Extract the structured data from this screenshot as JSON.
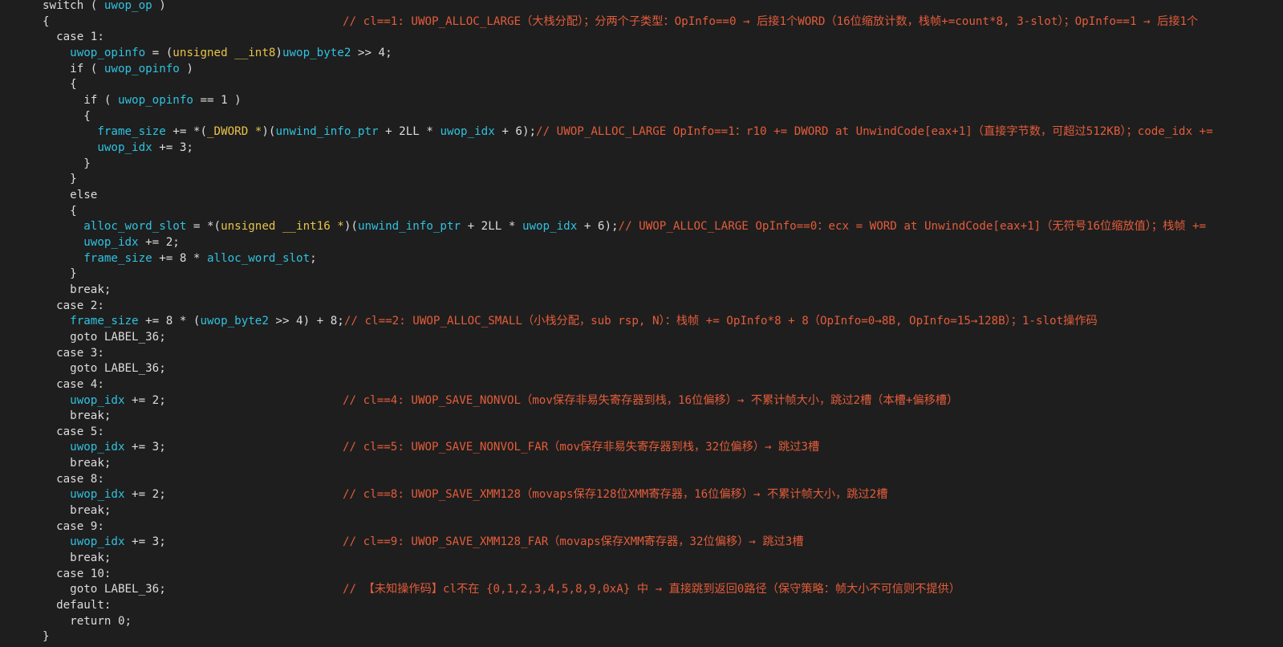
{
  "lines": [
    {
      "segs": [
        [
          "kw",
          "switch ( "
        ],
        [
          "var",
          "uwop_op"
        ],
        [
          "kw",
          " )"
        ]
      ]
    },
    {
      "segs": [
        [
          "kw",
          "{"
        ]
      ],
      "comment": "// cl==1: UWOP_ALLOC_LARGE（大栈分配）；分两个子类型：OpInfo==0 → 后接1个WORD（16位缩放计数，栈帧+=count*8, 3-slot）；OpInfo==1 → 后接1个"
    },
    {
      "segs": [
        [
          "kw",
          "  case 1:"
        ]
      ]
    },
    {
      "segs": [
        [
          "var",
          "    uwop_opinfo"
        ],
        [
          "op",
          " = ("
        ],
        [
          "typ",
          "unsigned __int8"
        ],
        [
          "op",
          ")"
        ],
        [
          "var",
          "uwop_byte2"
        ],
        [
          "op",
          " >> 4;"
        ]
      ]
    },
    {
      "segs": [
        [
          "kw",
          "    if ( "
        ],
        [
          "var",
          "uwop_opinfo"
        ],
        [
          "kw",
          " )"
        ]
      ]
    },
    {
      "segs": [
        [
          "kw",
          "    {"
        ]
      ]
    },
    {
      "segs": [
        [
          "kw",
          "      if ( "
        ],
        [
          "var",
          "uwop_opinfo"
        ],
        [
          "kw",
          " == 1 )"
        ]
      ]
    },
    {
      "segs": [
        [
          "kw",
          "      {"
        ]
      ]
    },
    {
      "segs": [
        [
          "var",
          "        frame_size"
        ],
        [
          "op",
          " += *("
        ],
        [
          "typ",
          "_DWORD *"
        ],
        [
          "op",
          ")("
        ],
        [
          "var",
          "unwind_info_ptr"
        ],
        [
          "op",
          " + 2LL * "
        ],
        [
          "var",
          "uwop_idx"
        ],
        [
          "op",
          " + 6);"
        ]
      ],
      "inline": "// UWOP_ALLOC_LARGE OpInfo==1：r10 += DWORD at UnwindCode[eax+1]（直接字节数，可超过512KB）；code_idx +="
    },
    {
      "segs": [
        [
          "var",
          "        uwop_idx"
        ],
        [
          "op",
          " += 3;"
        ]
      ]
    },
    {
      "segs": [
        [
          "kw",
          "      }"
        ]
      ]
    },
    {
      "segs": [
        [
          "kw",
          "    }"
        ]
      ]
    },
    {
      "segs": [
        [
          "kw",
          "    else"
        ]
      ]
    },
    {
      "segs": [
        [
          "kw",
          "    {"
        ]
      ]
    },
    {
      "segs": [
        [
          "var",
          "      alloc_word_slot"
        ],
        [
          "op",
          " = *("
        ],
        [
          "typ",
          "unsigned __int16 *"
        ],
        [
          "op",
          ")("
        ],
        [
          "var",
          "unwind_info_ptr"
        ],
        [
          "op",
          " + 2LL * "
        ],
        [
          "var",
          "uwop_idx"
        ],
        [
          "op",
          " + 6);"
        ]
      ],
      "inline": "// UWOP_ALLOC_LARGE OpInfo==0：ecx = WORD at UnwindCode[eax+1]（无符号16位缩放值）；栈帧 +="
    },
    {
      "segs": [
        [
          "var",
          "      uwop_idx"
        ],
        [
          "op",
          " += 2;"
        ]
      ]
    },
    {
      "segs": [
        [
          "var",
          "      frame_size"
        ],
        [
          "op",
          " += 8 * "
        ],
        [
          "var",
          "alloc_word_slot"
        ],
        [
          "op",
          ";"
        ]
      ]
    },
    {
      "segs": [
        [
          "kw",
          "    }"
        ]
      ]
    },
    {
      "segs": [
        [
          "kw",
          "    break;"
        ]
      ]
    },
    {
      "segs": [
        [
          "kw",
          "  case 2:"
        ]
      ]
    },
    {
      "segs": [
        [
          "var",
          "    frame_size"
        ],
        [
          "op",
          " += 8 * ("
        ],
        [
          "var",
          "uwop_byte2"
        ],
        [
          "op",
          " >> 4) + 8;"
        ]
      ],
      "inline": "// cl==2: UWOP_ALLOC_SMALL（小栈分配，sub rsp, N）：栈帧 += OpInfo*8 + 8（OpInfo=0→8B, OpInfo=15→128B）；1-slot操作码"
    },
    {
      "segs": [
        [
          "kw",
          "    goto LABEL_36;"
        ]
      ]
    },
    {
      "segs": [
        [
          "kw",
          "  case 3:"
        ]
      ]
    },
    {
      "segs": [
        [
          "kw",
          "    goto LABEL_36;"
        ]
      ]
    },
    {
      "segs": [
        [
          "kw",
          "  case 4:"
        ]
      ]
    },
    {
      "segs": [
        [
          "var",
          "    uwop_idx"
        ],
        [
          "op",
          " += 2;"
        ]
      ],
      "comment": "// cl==4: UWOP_SAVE_NONVOL（mov保存非易失寄存器到栈，16位偏移）→ 不累计帧大小，跳过2槽（本槽+偏移槽）"
    },
    {
      "segs": [
        [
          "kw",
          "    break;"
        ]
      ]
    },
    {
      "segs": [
        [
          "kw",
          "  case 5:"
        ]
      ]
    },
    {
      "segs": [
        [
          "var",
          "    uwop_idx"
        ],
        [
          "op",
          " += 3;"
        ]
      ],
      "comment": "// cl==5: UWOP_SAVE_NONVOL_FAR（mov保存非易失寄存器到栈，32位偏移）→ 跳过3槽"
    },
    {
      "segs": [
        [
          "kw",
          "    break;"
        ]
      ]
    },
    {
      "segs": [
        [
          "kw",
          "  case 8:"
        ]
      ]
    },
    {
      "segs": [
        [
          "var",
          "    uwop_idx"
        ],
        [
          "op",
          " += 2;"
        ]
      ],
      "comment": "// cl==8: UWOP_SAVE_XMM128（movaps保存128位XMM寄存器，16位偏移）→ 不累计帧大小，跳过2槽"
    },
    {
      "segs": [
        [
          "kw",
          "    break;"
        ]
      ]
    },
    {
      "segs": [
        [
          "kw",
          "  case 9:"
        ]
      ]
    },
    {
      "segs": [
        [
          "var",
          "    uwop_idx"
        ],
        [
          "op",
          " += 3;"
        ]
      ],
      "comment": "// cl==9: UWOP_SAVE_XMM128_FAR（movaps保存XMM寄存器，32位偏移）→ 跳过3槽"
    },
    {
      "segs": [
        [
          "kw",
          "    break;"
        ]
      ]
    },
    {
      "segs": [
        [
          "kw",
          "  case 10:"
        ]
      ]
    },
    {
      "segs": [
        [
          "kw",
          "    goto LABEL_36;"
        ]
      ],
      "comment": "// 【未知操作码】cl不在 {0,1,2,3,4,5,8,9,0xA} 中 → 直接跳到返回0路径（保守策略：帧大小不可信则不提供）"
    },
    {
      "segs": [
        [
          "kw",
          "  default:"
        ]
      ]
    },
    {
      "segs": [
        [
          "kw",
          "    return 0;"
        ]
      ]
    },
    {
      "segs": [
        [
          "kw",
          "}"
        ]
      ]
    }
  ],
  "colors": {
    "background": "#1e1e1e",
    "text": "#dcdcdc",
    "variable": "#2fc2e0",
    "type": "#e8c24a",
    "comment": "#e35c3a"
  }
}
